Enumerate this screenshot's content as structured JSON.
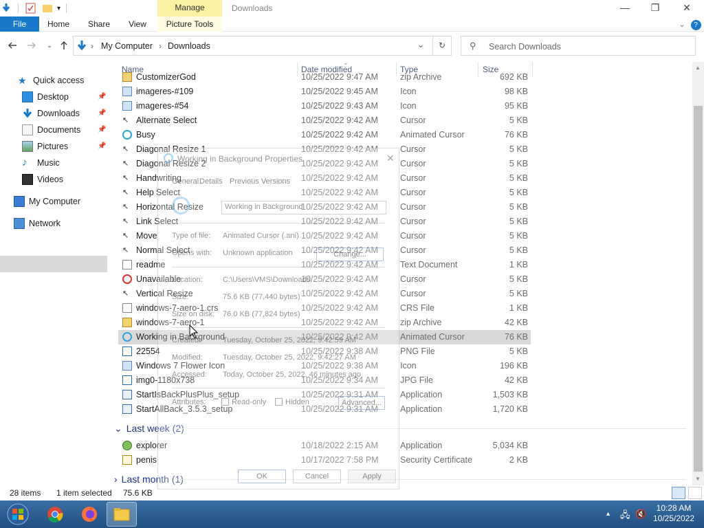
{
  "window": {
    "title": "Downloads",
    "context_tab": "Manage",
    "minimize": "—",
    "maximize": "❐",
    "close": "✕"
  },
  "ribbon": {
    "tabs": [
      "File",
      "Home",
      "Share",
      "View",
      "Picture Tools"
    ],
    "help": "?"
  },
  "address": {
    "path": [
      "My Computer",
      "Downloads"
    ],
    "search_placeholder": "Search Downloads"
  },
  "nav": {
    "quick_access": "Quick access",
    "items": [
      "Desktop",
      "Downloads",
      "Documents",
      "Pictures",
      "Music",
      "Videos"
    ],
    "my_computer": "My Computer",
    "network": "Network"
  },
  "columns": {
    "name": "Name",
    "date": "Date modified",
    "type": "Type",
    "size": "Size"
  },
  "files": [
    {
      "name": "CustomizerGod",
      "date": "10/25/2022 9:47 AM",
      "type": "zip Archive",
      "size": "692 KB",
      "icon": "zip-icon"
    },
    {
      "name": "imageres-#109",
      "date": "10/25/2022 9:45 AM",
      "type": "Icon",
      "size": "98 KB",
      "icon": "icon-file-icon"
    },
    {
      "name": "imageres-#54",
      "date": "10/25/2022 9:43 AM",
      "type": "Icon",
      "size": "95 KB",
      "icon": "icon-file-icon"
    },
    {
      "name": "Alternate Select",
      "date": "10/25/2022 9:42 AM",
      "type": "Cursor",
      "size": "5 KB",
      "icon": "cursor-icon"
    },
    {
      "name": "Busy",
      "date": "10/25/2022 9:42 AM",
      "type": "Animated Cursor",
      "size": "76 KB",
      "icon": "busy-cursor-icon"
    },
    {
      "name": "Diagonal Resize 1",
      "date": "10/25/2022 9:42 AM",
      "type": "Cursor",
      "size": "5 KB",
      "icon": "cursor-icon"
    },
    {
      "name": "Diagonal Resize 2",
      "date": "10/25/2022 9:42 AM",
      "type": "Cursor",
      "size": "5 KB",
      "icon": "cursor-icon"
    },
    {
      "name": "Handwriting",
      "date": "10/25/2022 9:42 AM",
      "type": "Cursor",
      "size": "5 KB",
      "icon": "cursor-icon"
    },
    {
      "name": "Help Select",
      "date": "10/25/2022 9:42 AM",
      "type": "Cursor",
      "size": "5 KB",
      "icon": "cursor-icon"
    },
    {
      "name": "Horizontal Resize",
      "date": "10/25/2022 9:42 AM",
      "type": "Cursor",
      "size": "5 KB",
      "icon": "cursor-icon"
    },
    {
      "name": "Link Select",
      "date": "10/25/2022 9:42 AM",
      "type": "Cursor",
      "size": "5 KB",
      "icon": "cursor-icon"
    },
    {
      "name": "Move",
      "date": "10/25/2022 9:42 AM",
      "type": "Cursor",
      "size": "5 KB",
      "icon": "cursor-icon"
    },
    {
      "name": "Normal Select",
      "date": "10/25/2022 9:42 AM",
      "type": "Cursor",
      "size": "5 KB",
      "icon": "cursor-icon"
    },
    {
      "name": "readme",
      "date": "10/25/2022 9:42 AM",
      "type": "Text Document",
      "size": "1 KB",
      "icon": "text-file-icon"
    },
    {
      "name": "Unavailable",
      "date": "10/25/2022 9:42 AM",
      "type": "Cursor",
      "size": "5 KB",
      "icon": "unavailable-cursor-icon"
    },
    {
      "name": "Vertical Resize",
      "date": "10/25/2022 9:42 AM",
      "type": "Cursor",
      "size": "5 KB",
      "icon": "cursor-icon"
    },
    {
      "name": "windows-7-aero-1.crs",
      "date": "10/25/2022 9:42 AM",
      "type": "CRS File",
      "size": "1 KB",
      "icon": "blank-file-icon"
    },
    {
      "name": "windows-7-aero-1",
      "date": "10/25/2022 9:42 AM",
      "type": "zip Archive",
      "size": "42 KB",
      "icon": "zip-icon"
    },
    {
      "name": "Working in Background",
      "date": "10/25/2022 9:42 AM",
      "type": "Animated Cursor",
      "size": "76 KB",
      "icon": "busy-cursor-icon"
    },
    {
      "name": "22554",
      "date": "10/25/2022 9:38 AM",
      "type": "PNG File",
      "size": "5 KB",
      "icon": "image-file-icon"
    },
    {
      "name": "Windows 7 Flower Icon",
      "date": "10/25/2022 9:38 AM",
      "type": "Icon",
      "size": "196 KB",
      "icon": "icon-file-icon"
    },
    {
      "name": "img0-1180x738",
      "date": "10/25/2022 9:34 AM",
      "type": "JPG File",
      "size": "42 KB",
      "icon": "image-file-icon"
    },
    {
      "name": "StartIsBackPlusPlus_setup",
      "date": "10/25/2022 9:31 AM",
      "type": "Application",
      "size": "1,503 KB",
      "icon": "setup-icon"
    },
    {
      "name": "StartAllBack_3.5.3_setup",
      "date": "10/25/2022 9:31 AM",
      "type": "Application",
      "size": "1,720 KB",
      "icon": "setup-icon"
    }
  ],
  "last_week": {
    "label": "Last week (2)",
    "files": [
      {
        "name": "explorer",
        "date": "10/18/2022 2:15 AM",
        "type": "Application",
        "size": "5,034 KB",
        "icon": "explorer-icon"
      },
      {
        "name": "penis",
        "date": "10/17/2022 7:58 PM",
        "type": "Security Certificate",
        "size": "2 KB",
        "icon": "certificate-icon"
      }
    ]
  },
  "last_month": {
    "label": "Last month (1)"
  },
  "status": {
    "items": "28 items",
    "selected": "1 item selected",
    "size": "75.6 KB"
  },
  "dialog": {
    "title": "Working in Background Properties",
    "tabs": [
      "General",
      "Details",
      "Previous Versions"
    ],
    "filename": "Working in Background",
    "type_label": "Type of file:",
    "type_value": "Animated Cursor (.ani)",
    "opens_label": "Opens with:",
    "opens_value": "Unknown application",
    "change": "Change...",
    "location_label": "Location:",
    "location_value": "C:\\Users\\VMS\\Downloads",
    "size_label": "Size:",
    "size_value": "75.6 KB (77,440 bytes)",
    "disk_label": "Size on disk:",
    "disk_value": "76.0 KB (77,824 bytes)",
    "created_label": "Created:",
    "created_value": "Tuesday, October 25, 2022, 9:42:59 AM",
    "modified_label": "Modified:",
    "modified_value": "Tuesday, October 25, 2022, 9:42:27 AM",
    "accessed_label": "Accessed:",
    "accessed_value": "Today, October 25, 2022, 46 minutes ago",
    "attr_label": "Attributes:",
    "readonly": "Read-only",
    "hidden": "Hidden",
    "advanced": "Advanced...",
    "ok": "OK",
    "cancel": "Cancel",
    "apply": "Apply"
  },
  "taskbar": {
    "time": "10:28 AM",
    "date": "10/25/2022"
  }
}
